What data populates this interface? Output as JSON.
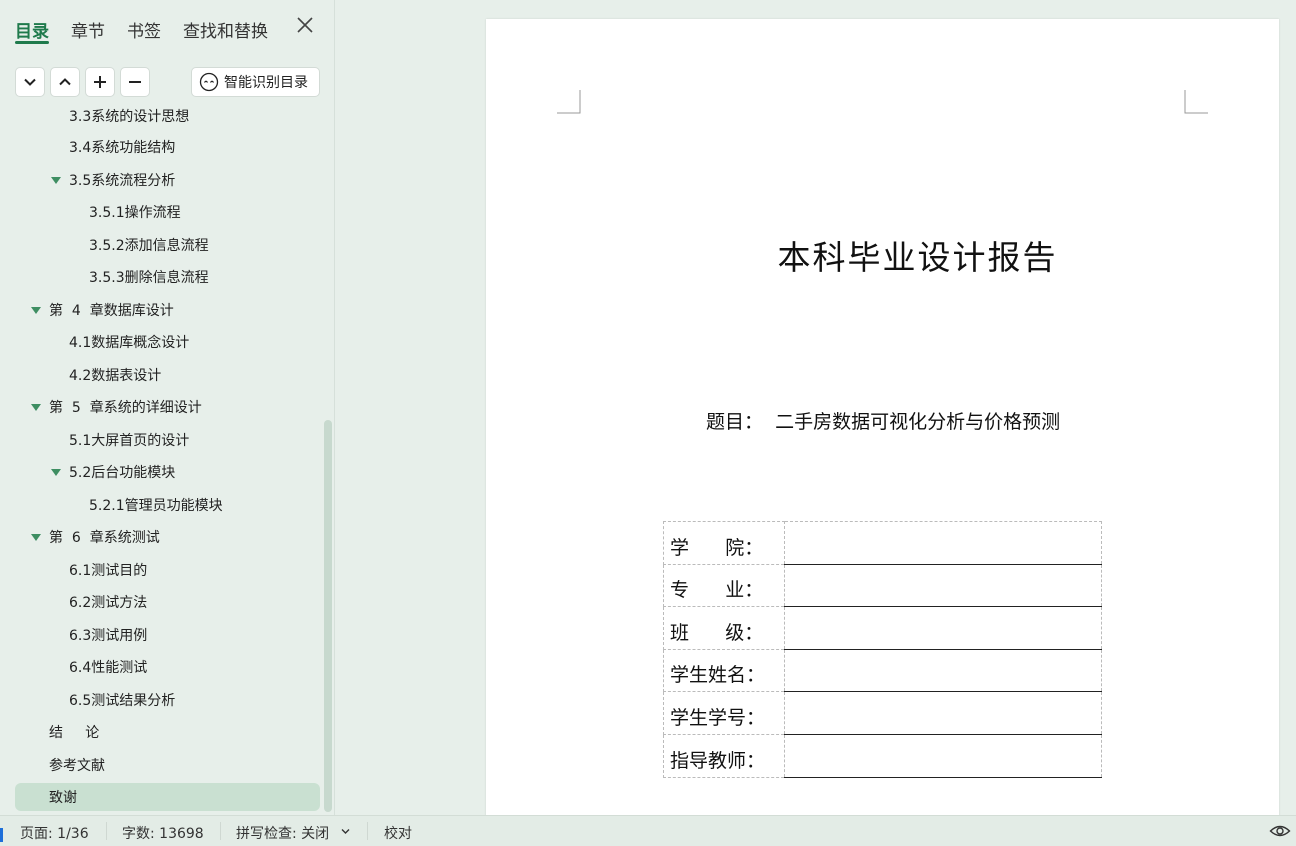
{
  "sidebar": {
    "tabs": [
      {
        "label": "目录"
      },
      {
        "label": "章节"
      },
      {
        "label": "书签"
      },
      {
        "label": "查找和替换"
      }
    ],
    "smart_button_label": "智能识别目录",
    "toc": [
      {
        "label": "3.3系统的设计思想"
      },
      {
        "label": "3.4系统功能结构"
      },
      {
        "label": "3.5系统流程分析"
      },
      {
        "label": "3.5.1操作流程"
      },
      {
        "label": "3.5.2添加信息流程"
      },
      {
        "label": "3.5.3删除信息流程"
      },
      {
        "label": "第  4  章数据库设计"
      },
      {
        "label": "4.1数据库概念设计"
      },
      {
        "label": "4.2数据表设计"
      },
      {
        "label": "第  5  章系统的详细设计"
      },
      {
        "label": "5.1大屏首页的设计"
      },
      {
        "label": "5.2后台功能模块"
      },
      {
        "label": "5.2.1管理员功能模块"
      },
      {
        "label": "第  6  章系统测试"
      },
      {
        "label": "6.1测试目的"
      },
      {
        "label": "6.2测试方法"
      },
      {
        "label": "6.3测试用例"
      },
      {
        "label": "6.4性能测试"
      },
      {
        "label": "6.5测试结果分析"
      },
      {
        "label": "结     论"
      },
      {
        "label": "参考文献"
      },
      {
        "label": "致谢"
      }
    ]
  },
  "document": {
    "title": "本科毕业设计报告",
    "subject": "题目：  二手房数据可视化分析与价格预测",
    "fields": [
      {
        "label": "学      院："
      },
      {
        "label": "专      业："
      },
      {
        "label": "班      级："
      },
      {
        "label": "学生姓名："
      },
      {
        "label": "学生学号："
      },
      {
        "label": "指导教师："
      }
    ]
  },
  "statusbar": {
    "page": "页面: 1/36",
    "word_count": "字数: 13698",
    "spell_check": "拼写检查: 关闭",
    "proofread": "校对"
  }
}
